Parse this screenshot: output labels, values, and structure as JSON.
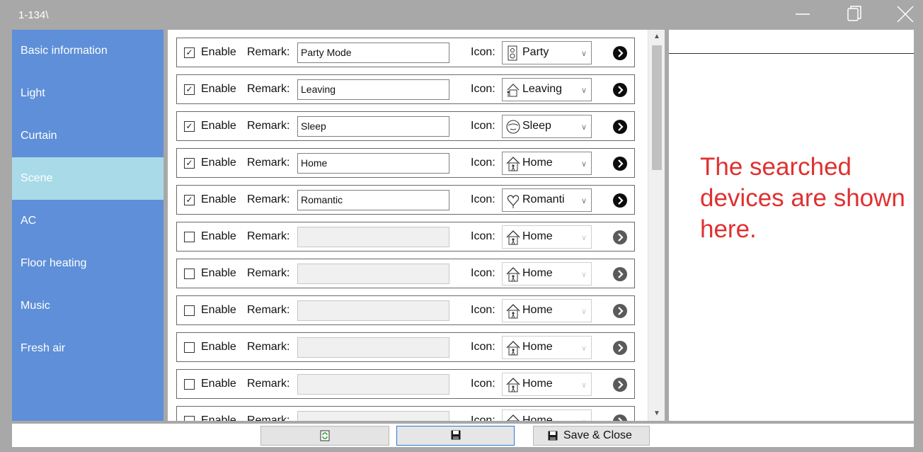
{
  "window": {
    "title": "1-134\\"
  },
  "sidebar": {
    "items": [
      {
        "label": "Basic information",
        "active": false
      },
      {
        "label": "Light",
        "active": false
      },
      {
        "label": "Curtain",
        "active": false
      },
      {
        "label": "Scene",
        "active": true
      },
      {
        "label": "AC",
        "active": false
      },
      {
        "label": "Floor heating",
        "active": false
      },
      {
        "label": "Music",
        "active": false
      },
      {
        "label": "Fresh air",
        "active": false
      }
    ]
  },
  "scene_list": {
    "enable_label": "Enable",
    "remark_label": "Remark:",
    "icon_label": "Icon:",
    "rows": [
      {
        "enabled": true,
        "remark": "Party Mode",
        "icon": "Party",
        "icon_name": "party-icon"
      },
      {
        "enabled": true,
        "remark": "Leaving",
        "icon": "Leaving",
        "icon_name": "leaving-icon"
      },
      {
        "enabled": true,
        "remark": "Sleep",
        "icon": "Sleep",
        "icon_name": "sleep-icon"
      },
      {
        "enabled": true,
        "remark": "Home",
        "icon": "Home",
        "icon_name": "home-icon"
      },
      {
        "enabled": true,
        "remark": "Romantic",
        "icon": "Romanti",
        "icon_name": "romantic-icon"
      },
      {
        "enabled": false,
        "remark": "",
        "icon": "Home",
        "icon_name": "home-icon"
      },
      {
        "enabled": false,
        "remark": "",
        "icon": "Home",
        "icon_name": "home-icon"
      },
      {
        "enabled": false,
        "remark": "",
        "icon": "Home",
        "icon_name": "home-icon"
      },
      {
        "enabled": false,
        "remark": "",
        "icon": "Home",
        "icon_name": "home-icon"
      },
      {
        "enabled": false,
        "remark": "",
        "icon": "Home",
        "icon_name": "home-icon"
      },
      {
        "enabled": false,
        "remark": "",
        "icon": "Home",
        "icon_name": "home-icon"
      }
    ]
  },
  "right_panel": {
    "note": "The searched devices are shown here."
  },
  "bottom": {
    "save_close_label": "Save & Close"
  }
}
